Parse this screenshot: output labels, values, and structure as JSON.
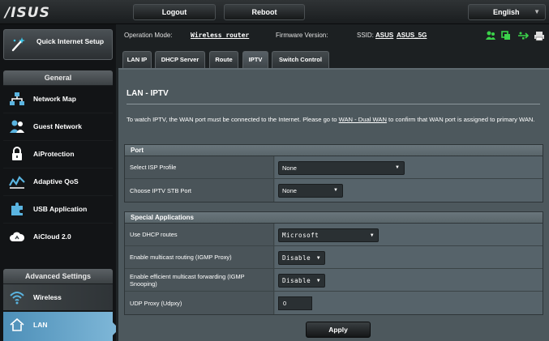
{
  "brand": {
    "logo_text": "/ISUS"
  },
  "topbar": {
    "logout_label": "Logout",
    "reboot_label": "Reboot",
    "language_label": "English"
  },
  "sidebar": {
    "quick_setup_label": "Quick Internet Setup",
    "general_header": "General",
    "general_items": [
      {
        "label": "Network Map",
        "icon": "network-map-icon"
      },
      {
        "label": "Guest Network",
        "icon": "guest-network-icon"
      },
      {
        "label": "AiProtection",
        "icon": "lock-icon"
      },
      {
        "label": "Adaptive QoS",
        "icon": "qos-icon"
      },
      {
        "label": "USB Application",
        "icon": "puzzle-icon"
      },
      {
        "label": "AiCloud 2.0",
        "icon": "cloud-icon"
      }
    ],
    "advanced_header": "Advanced Settings",
    "advanced_items": [
      {
        "label": "Wireless",
        "icon": "wifi-icon"
      },
      {
        "label": "LAN",
        "icon": "home-icon",
        "active": true
      }
    ]
  },
  "infobar": {
    "op_mode_label": "Operation Mode:",
    "op_mode_value": "Wireless router",
    "firmware_label": "Firmware Version:",
    "ssid_label": "SSID:",
    "ssid_1": "ASUS",
    "ssid_2": "ASUS_5G"
  },
  "tabs": [
    "LAN IP",
    "DHCP Server",
    "Route",
    "IPTV",
    "Switch Control"
  ],
  "active_tab": "IPTV",
  "page": {
    "title": "LAN - IPTV",
    "desc_part1": "To watch IPTV, the WAN port must be connected to the Internet. Please go to ",
    "desc_link": "WAN - Dual WAN",
    "desc_part2": " to confirm that WAN port is assigned to primary WAN."
  },
  "port_section": {
    "header": "Port",
    "rows": [
      {
        "label": "Select ISP Profile",
        "value": "None"
      },
      {
        "label": "Choose IPTV STB Port",
        "value": "None"
      }
    ]
  },
  "special_section": {
    "header": "Special Applications",
    "rows": [
      {
        "label": "Use DHCP routes",
        "value": "Microsoft"
      },
      {
        "label": "Enable multicast routing (IGMP Proxy)",
        "value": "Disable"
      },
      {
        "label": "Enable efficient multicast forwarding (IGMP Snooping)",
        "value": "Disable"
      },
      {
        "label": "UDP Proxy (Udpxy)",
        "value": "0"
      }
    ]
  },
  "apply_label": "Apply",
  "colors": {
    "accent_active": "#7cb5d6",
    "status_green": "#3bd24a",
    "panel_bg": "#4d585d"
  }
}
